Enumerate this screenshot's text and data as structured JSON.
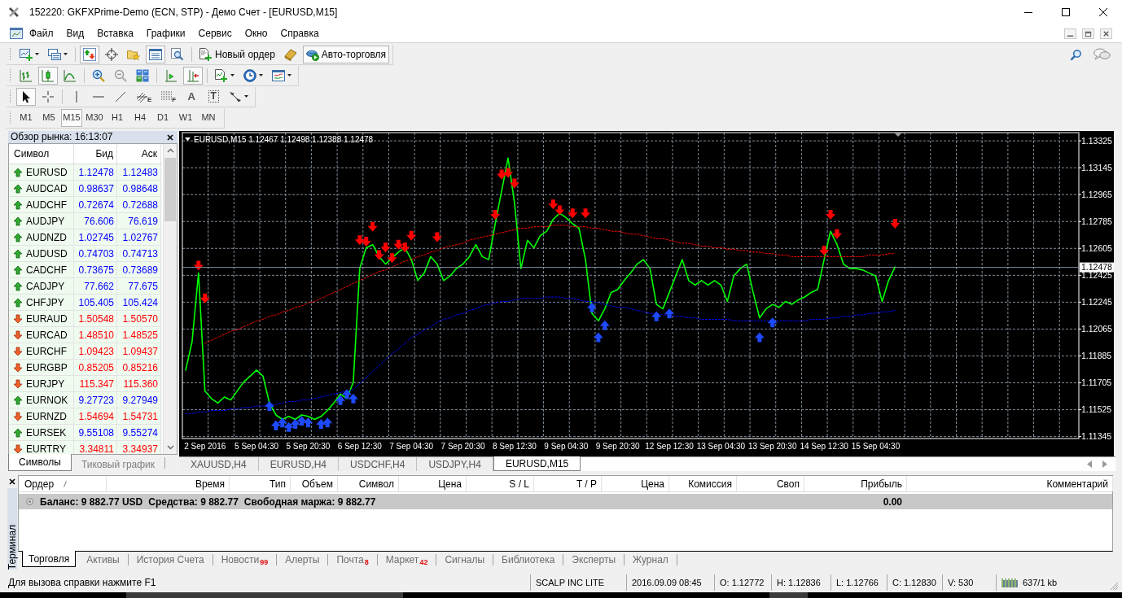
{
  "window": {
    "title": "152220: GKFXPrime-Demo (ECN, STP) - Демо Счет - [EURUSD,M15]"
  },
  "menu": [
    "Файл",
    "Вид",
    "Вставка",
    "Графики",
    "Сервис",
    "Окно",
    "Справка"
  ],
  "toolbars": [
    {
      "groups": [
        [
          {
            "kind": "newchart",
            "pressed": false
          },
          {
            "kind": "profiles",
            "pressed": false
          }
        ],
        [
          {
            "kind": "marketwatch",
            "pressed": true
          },
          {
            "kind": "datawindow",
            "pressed": false
          },
          {
            "kind": "navigator",
            "pressed": false
          },
          {
            "kind": "terminal",
            "pressed": true
          },
          {
            "kind": "tester",
            "pressed": false
          }
        ],
        [
          {
            "kind": "order",
            "label": "Новый ордер",
            "pressed": false
          },
          {
            "kind": "editor",
            "pressed": false
          },
          {
            "kind": "autotrading",
            "label": "Авто-торговля",
            "pressed": true
          }
        ]
      ]
    },
    {
      "groups": [
        [
          {
            "kind": "bars",
            "pressed": false
          },
          {
            "kind": "candles",
            "pressed": true
          },
          {
            "kind": "line",
            "pressed": false
          }
        ],
        [
          {
            "kind": "zoomin",
            "pressed": false
          },
          {
            "kind": "zoomout",
            "pressed": false
          },
          {
            "kind": "tile",
            "pressed": false
          }
        ],
        [
          {
            "kind": "shift",
            "pressed": false
          },
          {
            "kind": "autoscroll",
            "pressed": true
          }
        ],
        [
          {
            "kind": "indicators",
            "pressed": false
          },
          {
            "kind": "periods",
            "pressed": false
          },
          {
            "kind": "templates",
            "pressed": false
          }
        ]
      ]
    },
    {
      "groups": [
        [
          {
            "kind": "cursor",
            "pressed": true
          },
          {
            "kind": "crosshair",
            "pressed": false
          }
        ],
        [
          {
            "kind": "vline",
            "pressed": false
          },
          {
            "kind": "hline",
            "pressed": false
          },
          {
            "kind": "trendline",
            "pressed": false
          },
          {
            "kind": "channel",
            "glyph": "E",
            "pressed": false
          },
          {
            "kind": "fibo",
            "glyph": "F",
            "pressed": false
          },
          {
            "kind": "text",
            "glyph": "A",
            "pressed": false
          },
          {
            "kind": "label",
            "glyph": "T",
            "pressed": false
          },
          {
            "kind": "arrows",
            "pressed": false
          }
        ]
      ]
    }
  ],
  "timeframes": [
    {
      "label": "M1",
      "selected": false
    },
    {
      "label": "M5",
      "selected": false
    },
    {
      "label": "M15",
      "selected": true
    },
    {
      "label": "M30",
      "selected": false
    },
    {
      "label": "H1",
      "selected": false
    },
    {
      "label": "H4",
      "selected": false
    },
    {
      "label": "D1",
      "selected": false
    },
    {
      "label": "W1",
      "selected": false
    },
    {
      "label": "MN",
      "selected": false
    }
  ],
  "market_watch": {
    "title": "Обзор рынка: 16:13:07",
    "columns": [
      "Символ",
      "Бид",
      "Аск"
    ],
    "rows": [
      {
        "symbol": "EURUSD",
        "bid": "1.12478",
        "ask": "1.12483",
        "kind": "up"
      },
      {
        "symbol": "AUDCAD",
        "bid": "0.98637",
        "ask": "0.98648",
        "kind": "up"
      },
      {
        "symbol": "AUDCHF",
        "bid": "0.72674",
        "ask": "0.72688",
        "kind": "up"
      },
      {
        "symbol": "AUDJPY",
        "bid": "76.606",
        "ask": "76.619",
        "kind": "up"
      },
      {
        "symbol": "AUDNZD",
        "bid": "1.02745",
        "ask": "1.02767",
        "kind": "up"
      },
      {
        "symbol": "AUDUSD",
        "bid": "0.74703",
        "ask": "0.74713",
        "kind": "up"
      },
      {
        "symbol": "CADCHF",
        "bid": "0.73675",
        "ask": "0.73689",
        "kind": "up"
      },
      {
        "symbol": "CADJPY",
        "bid": "77.662",
        "ask": "77.675",
        "kind": "up"
      },
      {
        "symbol": "CHFJPY",
        "bid": "105.405",
        "ask": "105.424",
        "kind": "up"
      },
      {
        "symbol": "EURAUD",
        "bid": "1.50548",
        "ask": "1.50570",
        "kind": "down"
      },
      {
        "symbol": "EURCAD",
        "bid": "1.48510",
        "ask": "1.48525",
        "kind": "down"
      },
      {
        "symbol": "EURCHF",
        "bid": "1.09423",
        "ask": "1.09437",
        "kind": "down"
      },
      {
        "symbol": "EURGBP",
        "bid": "0.85205",
        "ask": "0.85216",
        "kind": "down"
      },
      {
        "symbol": "EURJPY",
        "bid": "115.347",
        "ask": "115.360",
        "kind": "down"
      },
      {
        "symbol": "EURNOK",
        "bid": "9.27723",
        "ask": "9.27949",
        "kind": "up"
      },
      {
        "symbol": "EURNZD",
        "bid": "1.54694",
        "ask": "1.54731",
        "kind": "down"
      },
      {
        "symbol": "EURSEK",
        "bid": "9.55108",
        "ask": "9.55274",
        "kind": "up"
      },
      {
        "symbol": "EURTRY",
        "bid": "3.34811",
        "ask": "3.34937",
        "kind": "down"
      }
    ],
    "tabs": [
      {
        "label": "Символы",
        "selected": true
      },
      {
        "label": "Тиковый график",
        "selected": false
      }
    ]
  },
  "chart": {
    "chart_data": [
      {
        "type": "line",
        "title": "EURUSD,M15 1.12467 1.12498 1.12388 1.12478",
        "categories": [
          null,
          null,
          null,
          "2 Sep 2016",
          null,
          null,
          null,
          null,
          null,
          null,
          null,
          "5 Sep 04:30",
          null,
          null,
          null,
          null,
          null,
          null,
          null,
          "5 Sep 20:30",
          null,
          null,
          null,
          null,
          null,
          null,
          null,
          "6 Sep 12:30",
          null,
          null,
          null,
          null,
          null,
          null,
          null,
          "7 Sep 04:30",
          null,
          null,
          null,
          null,
          null,
          null,
          null,
          "7 Sep 20:30",
          null,
          null,
          null,
          null,
          null,
          null,
          null,
          "8 Sep 12:30",
          null,
          null,
          null,
          null,
          null,
          null,
          null,
          "9 Sep 04:30",
          null,
          null,
          null,
          null,
          null,
          null,
          null,
          "9 Sep 20:30",
          null,
          null,
          null,
          null,
          null,
          null,
          null,
          "12 Sep 12:30",
          null,
          null,
          null,
          null,
          null,
          null,
          null,
          "13 Sep 04:30",
          null,
          null,
          null,
          null,
          null,
          null,
          null,
          "13 Sep 20:30",
          null,
          null,
          null,
          null,
          null,
          null,
          null,
          "14 Sep 12:30",
          null,
          null,
          null,
          null,
          null,
          null,
          null,
          "15 Sep 04:30",
          null,
          null,
          null,
          null,
          null,
          null,
          null,
          null,
          null,
          null,
          null,
          null,
          null,
          null,
          null,
          null,
          null,
          null,
          null,
          null,
          null,
          null,
          null,
          null,
          null,
          null,
          null,
          null,
          null,
          null,
          null
        ],
        "series": [
          {
            "type": "line",
            "color": "#00ff00",
            "values": [
              1.1179,
              1.1198,
              1.1244,
              1.1165,
              1.116,
              1.1157,
              1.1161,
              1.1159,
              1.1165,
              1.1171,
              1.1175,
              1.1179,
              1.1175,
              1.1157,
              1.1149,
              1.1146,
              1.1148,
              1.1146,
              1.1149,
              1.1148,
              1.1146,
              1.1148,
              1.1152,
              1.1157,
              1.1163,
              1.116,
              1.1171,
              1.1247,
              1.1261,
              1.1263,
              1.1255,
              1.125,
              1.1254,
              1.1258,
              1.1261,
              1.1253,
              1.1239,
              1.1244,
              1.1255,
              1.125,
              1.1239,
              1.1242,
              1.1247,
              1.125,
              1.1255,
              1.1263,
              1.1255,
              1.1253,
              1.1277,
              1.1299,
              1.1321,
              1.1291,
              1.1247,
              1.1266,
              1.1261,
              1.1269,
              1.1272,
              1.128,
              1.1284,
              1.1281,
              1.1277,
              1.1274,
              1.1253,
              1.1217,
              1.1212,
              1.122,
              1.1231,
              1.1233,
              1.1239,
              1.1244,
              1.125,
              1.1253,
              1.1247,
              1.1223,
              1.122,
              1.1231,
              1.1242,
              1.1253,
              1.1239,
              1.1236,
              1.1239,
              1.1236,
              1.1239,
              1.1236,
              1.1225,
              1.1242,
              1.1247,
              1.125,
              1.1231,
              1.1214,
              1.122,
              1.1223,
              1.1221,
              1.1225,
              1.1223,
              1.1226,
              1.1228,
              1.1231,
              1.1233,
              1.1253,
              1.1272,
              1.1263,
              1.125,
              1.1247,
              1.1247,
              1.1246,
              1.1244,
              1.1242,
              1.1225,
              1.1239,
              1.1248,
              null,
              null,
              null,
              null,
              null,
              null,
              null,
              null,
              null,
              null,
              null,
              null,
              null,
              null,
              null,
              null,
              null,
              null,
              null,
              null,
              null,
              null,
              null,
              null,
              null,
              null,
              null,
              null
            ]
          },
          {
            "type": "line",
            "color": "#ff0000",
            "line_style": "dotted",
            "values": [
              null,
              null,
              null,
              1.1197,
              1.1199,
              1.1201,
              1.1203,
              1.1205,
              1.1206,
              1.1208,
              1.121,
              1.1212,
              1.1213,
              1.1215,
              1.1216,
              1.1218,
              1.1219,
              1.1221,
              1.1222,
              1.1224,
              1.1225,
              1.1227,
              1.1229,
              1.1231,
              1.1233,
              1.1235,
              1.1237,
              1.1239,
              1.1241,
              1.1243,
              1.1245,
              1.1246,
              1.1248,
              1.125,
              1.1252,
              1.1253,
              1.1255,
              1.1256,
              1.1258,
              1.1259,
              1.1261,
              1.1262,
              1.1263,
              1.1264,
              1.1266,
              1.1267,
              1.1268,
              1.1269,
              1.127,
              1.1271,
              1.1272,
              1.1273,
              1.1274,
              1.1274,
              1.1275,
              1.1275,
              1.1275,
              1.1276,
              1.1276,
              1.1276,
              1.1275,
              1.1275,
              1.1275,
              1.1274,
              1.1274,
              1.1273,
              1.1272,
              1.1272,
              1.1271,
              1.127,
              1.127,
              1.1269,
              1.1268,
              1.1267,
              1.1267,
              1.1266,
              1.1265,
              1.1264,
              1.1264,
              1.1263,
              1.1262,
              1.1262,
              1.1261,
              1.1261,
              1.126,
              1.126,
              1.1259,
              1.1259,
              1.1258,
              1.1258,
              1.1257,
              1.1257,
              1.1256,
              1.1256,
              1.1255,
              1.1255,
              1.1255,
              1.1255,
              1.1255,
              1.1255,
              1.1255,
              1.1255,
              1.1255,
              1.1255,
              1.1255,
              1.1255,
              1.1256,
              1.1256,
              1.1256,
              1.1257,
              1.1257,
              null,
              null,
              null,
              null,
              null,
              null,
              null,
              null,
              null,
              null,
              null,
              null,
              null,
              null,
              null,
              null,
              null,
              null,
              null,
              null,
              null,
              null,
              null,
              null,
              null,
              null,
              null,
              null
            ]
          },
          {
            "type": "line",
            "color": "#0000ff",
            "line_style": "dotted",
            "values": [
              1.115,
              1.115,
              1.1151,
              1.1151,
              1.1152,
              1.1152,
              1.1152,
              1.1153,
              1.1153,
              1.1154,
              1.1154,
              1.1155,
              1.1155,
              1.1156,
              1.1156,
              1.1157,
              1.1158,
              1.1158,
              1.1159,
              1.1159,
              1.116,
              1.1161,
              1.1162,
              1.1163,
              1.1164,
              1.1165,
              1.1166,
              1.117,
              1.1174,
              1.1178,
              1.1182,
              1.1186,
              1.119,
              1.1193,
              1.1197,
              1.1201,
              1.1203,
              1.1206,
              1.1208,
              1.1211,
              1.1213,
              1.1214,
              1.1216,
              1.1217,
              1.1219,
              1.122,
              1.1222,
              1.1223,
              1.1224,
              1.1225,
              1.1225,
              1.1226,
              1.1227,
              1.1227,
              1.1227,
              1.1227,
              1.1228,
              1.1228,
              1.1228,
              1.1227,
              1.1227,
              1.1226,
              1.1225,
              1.1225,
              1.1224,
              1.1223,
              1.1222,
              1.1221,
              1.1221,
              1.122,
              1.1219,
              1.1218,
              1.1217,
              1.1217,
              1.1216,
              1.1216,
              1.1215,
              1.1215,
              1.1214,
              1.1214,
              1.1213,
              1.1213,
              1.1213,
              1.1213,
              1.1213,
              1.1212,
              1.1212,
              1.1212,
              1.1212,
              1.1212,
              1.1212,
              1.1212,
              1.1212,
              1.1212,
              1.1212,
              1.1212,
              1.1212,
              1.1213,
              1.1213,
              1.1213,
              1.1214,
              1.1214,
              1.1215,
              1.1215,
              1.1216,
              1.1216,
              1.1217,
              1.1217,
              1.1218,
              1.1218,
              1.1219,
              null,
              null,
              null,
              null,
              null,
              null,
              null,
              null,
              null,
              null,
              null,
              null,
              null,
              null,
              null,
              null,
              null,
              null,
              null,
              null,
              null,
              null,
              null,
              null,
              null,
              null,
              null,
              null
            ]
          },
          {
            "type": "scatter",
            "color": "#ff0000",
            "values": [
              null,
              null,
              1.1249,
              1.1227,
              null,
              null,
              null,
              null,
              null,
              null,
              null,
              null,
              null,
              null,
              null,
              null,
              null,
              null,
              null,
              null,
              null,
              null,
              null,
              null,
              null,
              null,
              null,
              1.1266,
              1.1265,
              1.1275,
              1.1256,
              1.1261,
              1.1254,
              1.1263,
              1.1261,
              1.1269,
              null,
              null,
              null,
              1.1268,
              null,
              null,
              null,
              null,
              null,
              null,
              null,
              null,
              1.1283,
              1.131,
              1.1311,
              1.1304,
              null,
              null,
              null,
              null,
              null,
              1.129,
              1.1286,
              null,
              1.1284,
              null,
              1.1284,
              null,
              null,
              null,
              null,
              null,
              null,
              null,
              null,
              null,
              null,
              null,
              null,
              null,
              null,
              null,
              null,
              null,
              null,
              null,
              null,
              null,
              null,
              null,
              null,
              null,
              null,
              null,
              null,
              null,
              null,
              null,
              null,
              null,
              null,
              null,
              null,
              1.1259,
              1.1283,
              1.127,
              null,
              null,
              null,
              null,
              null,
              null,
              null,
              null,
              1.1277,
              null,
              null,
              null,
              null,
              null,
              null,
              null,
              null,
              null,
              null,
              null,
              null,
              null,
              null,
              null,
              null,
              null,
              null,
              null,
              null,
              null,
              null,
              null,
              null,
              null,
              null,
              null,
              null
            ]
          },
          {
            "type": "scatter",
            "color": "#1e4bff",
            "values": [
              null,
              null,
              null,
              null,
              null,
              null,
              null,
              null,
              null,
              null,
              null,
              null,
              null,
              1.1155,
              1.1142,
              1.1144,
              1.1141,
              1.1143,
              1.1145,
              1.1144,
              null,
              1.1143,
              1.1144,
              null,
              1.1159,
              1.1163,
              1.116,
              null,
              null,
              null,
              null,
              null,
              null,
              null,
              null,
              null,
              null,
              null,
              null,
              null,
              null,
              null,
              null,
              null,
              null,
              null,
              null,
              null,
              null,
              null,
              null,
              null,
              null,
              null,
              null,
              null,
              null,
              null,
              null,
              null,
              null,
              null,
              null,
              1.1221,
              1.1201,
              1.1209,
              null,
              null,
              null,
              null,
              null,
              null,
              null,
              1.1215,
              null,
              1.1217,
              null,
              null,
              null,
              null,
              null,
              null,
              null,
              null,
              null,
              null,
              null,
              null,
              null,
              1.1201,
              null,
              1.1211,
              null,
              null,
              null,
              null,
              null,
              null,
              null,
              null,
              null,
              null,
              null,
              null,
              null,
              null,
              null,
              null,
              null,
              null,
              null,
              null,
              null,
              null,
              null,
              null,
              null,
              null,
              null,
              null,
              null,
              null,
              null,
              null,
              null,
              null,
              null,
              null,
              null,
              null,
              null,
              null,
              null,
              null,
              null,
              null,
              null,
              null,
              null
            ]
          }
        ],
        "yticks": [
          1.13325,
          1.13145,
          1.12965,
          1.12785,
          1.12605,
          1.12425,
          1.12245,
          1.12065,
          1.11885,
          1.11705,
          1.11525,
          1.11345
        ],
        "ylim": [
          1.11332,
          1.1338
        ],
        "grid": true,
        "ref_lines": [
          {
            "axis": "y",
            "value": 1.12478,
            "label": "1.12478",
            "color": "#8090a0"
          }
        ]
      }
    ]
  },
  "chart_tabs": [
    {
      "label": "XAUUSD,H4",
      "selected": false
    },
    {
      "label": "EURUSD,H4",
      "selected": false
    },
    {
      "label": "USDCHF,H4",
      "selected": false
    },
    {
      "label": "USDJPY,H4",
      "selected": false
    },
    {
      "label": "EURUSD,M15",
      "selected": true
    }
  ],
  "terminal": {
    "title": "Терминал",
    "columns": [
      {
        "label": "Ордер",
        "sorted": true
      },
      {
        "label": "Время",
        "sorted": false
      },
      {
        "label": "Тип",
        "sorted": false
      },
      {
        "label": "Объем",
        "sorted": false
      },
      {
        "label": "Символ",
        "sorted": false
      },
      {
        "label": "Цена",
        "sorted": false
      },
      {
        "label": "S / L",
        "sorted": false
      },
      {
        "label": "T / P",
        "sorted": false
      },
      {
        "label": "Цена",
        "sorted": false
      },
      {
        "label": "Комиссия",
        "sorted": false
      },
      {
        "label": "Своп",
        "sorted": false
      },
      {
        "label": "Прибыль",
        "sorted": false
      },
      {
        "label": "Комментарий",
        "sorted": false
      }
    ],
    "balance": {
      "items": [
        "Баланс: 9 882.77 USD",
        "Средства: 9 882.77",
        "Свободная маржа: 9 882.77"
      ],
      "profit": "0.00"
    },
    "tabs": [
      {
        "label": "Торговля",
        "selected": true
      },
      {
        "label": "Активы",
        "selected": false
      },
      {
        "label": "История Счета",
        "selected": false
      },
      {
        "label": "Новости",
        "badge": "99",
        "selected": false
      },
      {
        "label": "Алерты",
        "selected": false
      },
      {
        "label": "Почта",
        "badge": "8",
        "selected": false
      },
      {
        "label": "Маркет",
        "badge": "42",
        "selected": false
      },
      {
        "label": "Сигналы",
        "selected": false
      },
      {
        "label": "Библиотека",
        "selected": false
      },
      {
        "label": "Эксперты",
        "selected": false
      },
      {
        "label": "Журнал",
        "selected": false
      }
    ]
  },
  "status_bar": {
    "help": "Для вызова справки нажмите F1",
    "fields": [
      {
        "kind": "profile",
        "text": "SCALP INC LITE"
      },
      {
        "kind": "time",
        "text": "2016.09.09 08:45"
      },
      {
        "kind": "open",
        "text": "O: 1.12772"
      },
      {
        "kind": "high",
        "text": "H: 1.12836"
      },
      {
        "kind": "low",
        "text": "L: 1.12766"
      },
      {
        "kind": "close",
        "text": "C: 1.12830"
      },
      {
        "kind": "volume",
        "text": "V: 530"
      },
      {
        "kind": "traffic",
        "text": "637/1 kb"
      }
    ]
  }
}
